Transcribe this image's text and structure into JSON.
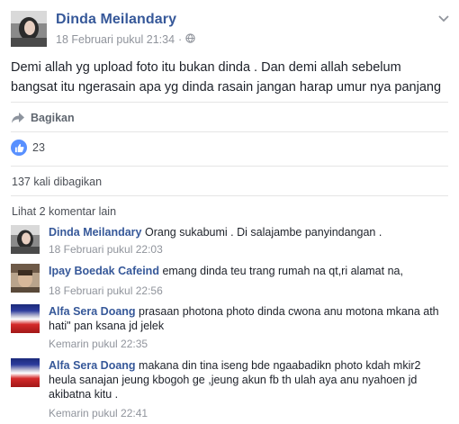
{
  "post": {
    "author": "Dinda Meilandary",
    "timestamp": "18 Februari pukul 21:34",
    "separator": "·",
    "audience_icon": "globe-icon",
    "text": "Demi allah yg upload foto itu bukan dinda . Dan demi allah sebelum bangsat itu ngerasain apa yg dinda rasain jangan harap umur nya panjang",
    "share_label": "Bagikan",
    "like_count": "23",
    "shares_text": "137 kali dibagikan",
    "more_comments": "Lihat 2 komentar lain"
  },
  "comments": [
    {
      "author": "Dinda Meilandary",
      "text": "Orang sukabumi . Di salajambe panyindangan .",
      "time": "18 Februari pukul 22:03"
    },
    {
      "author": "Ipay Boedak Cafeind",
      "text": "emang dinda teu trang rumah na qt,ri alamat na,",
      "time": "18 Februari pukul 22:56"
    },
    {
      "author": "Alfa Sera Doang",
      "text": "prasaan photona photo dinda cwona anu motona mkana ath hati\" pan ksana jd jelek",
      "time": "Kemarin pukul 22:35"
    },
    {
      "author": "Alfa Sera Doang",
      "text": "makana din tina iseng bde ngaabadikn photo kdah mkir2 heula sanajan jeung kbogoh ge ,jeung akun fb th ulah aya anu nyahoen jd akibatna kitu .",
      "time": "Kemarin pukul 22:41"
    }
  ],
  "colors": {
    "link": "#365899",
    "meta": "#90949c",
    "like_blue": "#5890ff",
    "text": "#1d2129"
  }
}
